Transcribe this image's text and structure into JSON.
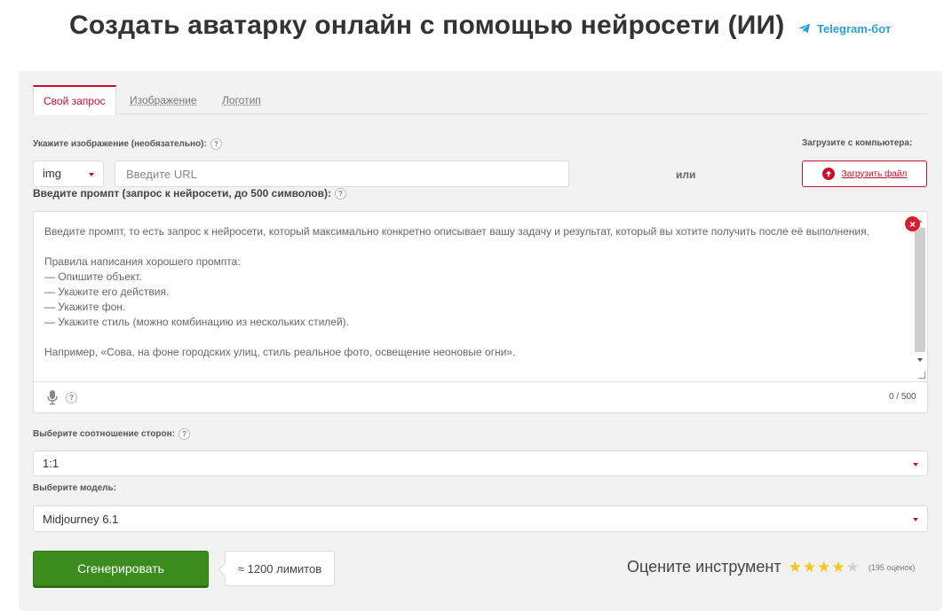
{
  "header": {
    "title": "Создать аватарку онлайн с помощью нейросети (ИИ)",
    "telegram_label": "Telegram-бот",
    "telegram_icon": "telegram-icon"
  },
  "tabs": [
    {
      "label": "Свой запрос",
      "active": true
    },
    {
      "label": "Изображение",
      "active": false
    },
    {
      "label": "Логотип",
      "active": false
    }
  ],
  "image_section": {
    "label": "Укажите изображение (необязательно):",
    "upload_label": "Загрузите с компьютера:",
    "format_selected": "img",
    "url_placeholder": "Введите URL",
    "or_text": "или",
    "upload_button": "Загрузить файл"
  },
  "prompt_section": {
    "label": "Введите промпт (запрос к нейросети, до 500 символов):",
    "placeholder_text": "Введите промпт, то есть запрос к нейросети, который максимально конкретно описывает вашу задачу и результат, который вы хотите получить после её выполнения.\n\nПравила написания хорошего промпта:\n— Опишите объект.\n— Укажите его действия.\n— Укажите фон.\n— Укажите стиль (можно комбинацию из нескольких стилей).\n\nНапример, «Сова, на фоне городских улиц, стиль реальное фото, освещение неоновые огни».",
    "counter": "0 / 500",
    "help": "?",
    "clear": "×"
  },
  "ratio_section": {
    "label": "Выберите соотношение сторон:",
    "selected": "1:1"
  },
  "model_section": {
    "label": "Выберите модель:",
    "selected": "Midjourney 6.1"
  },
  "actions": {
    "generate_button": "Сгенерировать",
    "limits": "≈ 1200 лимитов"
  },
  "rating": {
    "label": "Оцените инструмент",
    "stars": 4,
    "max": 5,
    "count": "(195 оценок)"
  },
  "colors": {
    "accent": "#c8102e",
    "generate": "#3b8c1d",
    "telegram": "#2a9fd8",
    "star": "#f5c518"
  }
}
